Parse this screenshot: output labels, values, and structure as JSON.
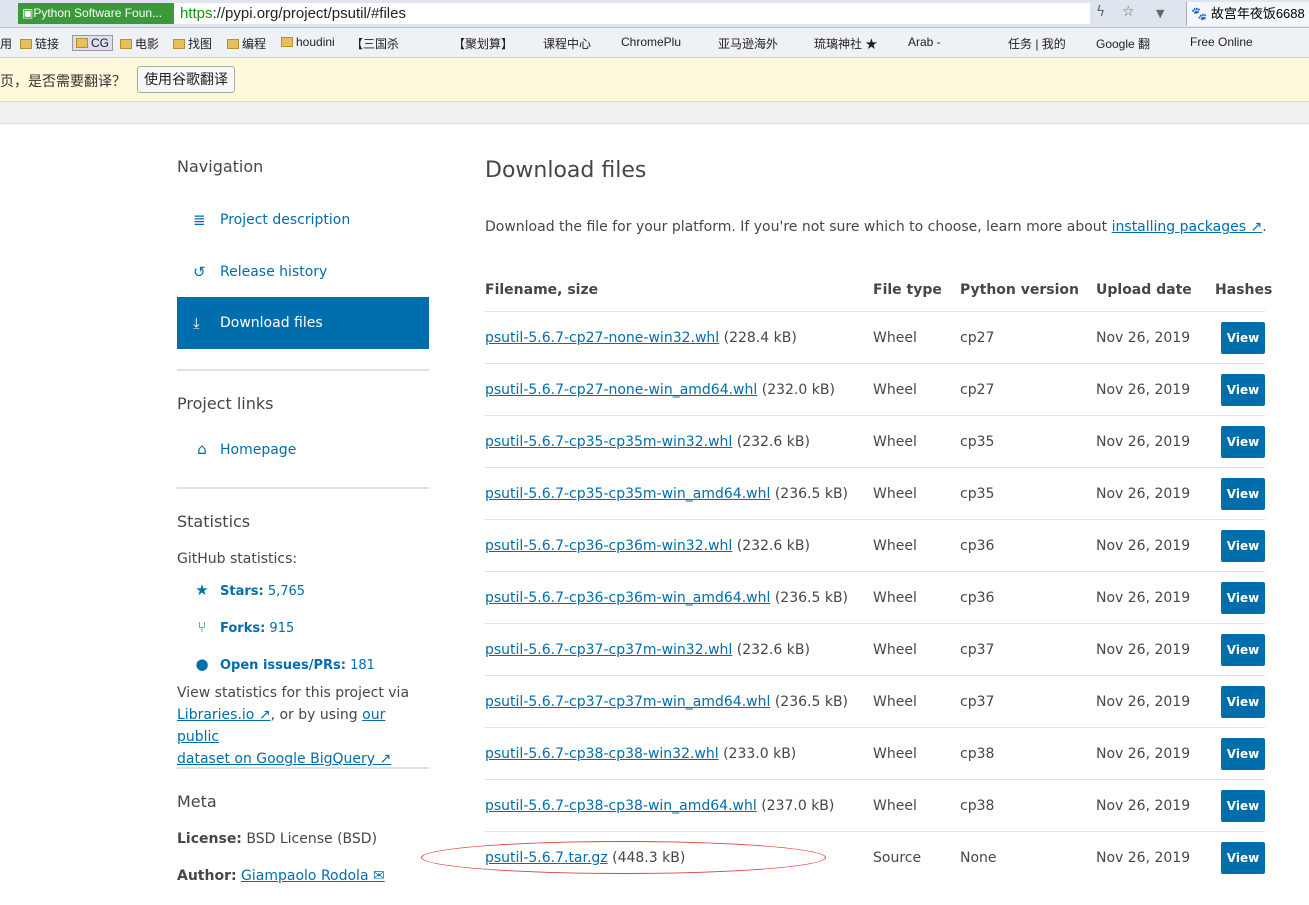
{
  "browser": {
    "site_badge": "Python Software Foun...",
    "url_protocol": "https",
    "url_rest": "://pypi.org/project/psutil/#files",
    "tab_title": "故宫年夜饭6688",
    "bookmarks": [
      "用",
      "链接",
      "CG",
      "电影",
      "找图",
      "编程",
      "houdini",
      "【三国杀",
      "【聚划算】",
      "课程中心",
      "ChromePlu",
      "亚马逊海外",
      "琉璃神社 ★",
      "Arab -",
      "任务 | 我的",
      "Google 翻",
      "Free Online"
    ]
  },
  "translate_bar": {
    "message": "页，是否需要翻译？",
    "button": "使用谷歌翻译"
  },
  "sidebar": {
    "navigation_title": "Navigation",
    "nav_items": [
      {
        "label": "Project description",
        "icon": "align-left-icon"
      },
      {
        "label": "Release history",
        "icon": "history-icon"
      },
      {
        "label": "Download files",
        "icon": "download-icon",
        "active": true
      }
    ],
    "project_links_title": "Project links",
    "homepage_label": "Homepage",
    "statistics_title": "Statistics",
    "github_stats_label": "GitHub statistics:",
    "stars_label": "Stars:",
    "stars_value": "5,765",
    "forks_label": "Forks:",
    "forks_value": "915",
    "issues_label": "Open issues/PRs:",
    "issues_value": "181",
    "stats_text_1": "View statistics for this project via",
    "libraries_link": "Libraries.io",
    "stats_text_2": ", or by using",
    "dataset_link_1": "our public",
    "dataset_link_2": "dataset on Google BigQuery",
    "meta_title": "Meta",
    "license_label": "License:",
    "license_value": "BSD License (BSD)",
    "author_label": "Author:",
    "author_value": "Giampaolo Rodola"
  },
  "main": {
    "title": "Download files",
    "intro_text": "Download the file for your platform. If you're not sure which to choose, learn more about",
    "intro_link": "installing packages",
    "intro_end": ".",
    "headers": {
      "filename": "Filename, size",
      "filetype": "File type",
      "pyversion": "Python version",
      "upload": "Upload date",
      "hashes": "Hashes"
    },
    "view_label": "View",
    "files": [
      {
        "name": "psutil-5.6.7-cp27-none-win32.whl",
        "size": "(228.4 kB)",
        "type": "Wheel",
        "py": "cp27",
        "date": "Nov 26, 2019"
      },
      {
        "name": "psutil-5.6.7-cp27-none-win_amd64.whl",
        "size": "(232.0 kB)",
        "type": "Wheel",
        "py": "cp27",
        "date": "Nov 26, 2019"
      },
      {
        "name": "psutil-5.6.7-cp35-cp35m-win32.whl",
        "size": "(232.6 kB)",
        "type": "Wheel",
        "py": "cp35",
        "date": "Nov 26, 2019"
      },
      {
        "name": "psutil-5.6.7-cp35-cp35m-win_amd64.whl",
        "size": "(236.5 kB)",
        "type": "Wheel",
        "py": "cp35",
        "date": "Nov 26, 2019"
      },
      {
        "name": "psutil-5.6.7-cp36-cp36m-win32.whl",
        "size": "(232.6 kB)",
        "type": "Wheel",
        "py": "cp36",
        "date": "Nov 26, 2019"
      },
      {
        "name": "psutil-5.6.7-cp36-cp36m-win_amd64.whl",
        "size": "(236.5 kB)",
        "type": "Wheel",
        "py": "cp36",
        "date": "Nov 26, 2019"
      },
      {
        "name": "psutil-5.6.7-cp37-cp37m-win32.whl",
        "size": "(232.6 kB)",
        "type": "Wheel",
        "py": "cp37",
        "date": "Nov 26, 2019"
      },
      {
        "name": "psutil-5.6.7-cp37-cp37m-win_amd64.whl",
        "size": "(236.5 kB)",
        "type": "Wheel",
        "py": "cp37",
        "date": "Nov 26, 2019"
      },
      {
        "name": "psutil-5.6.7-cp38-cp38-win32.whl",
        "size": "(233.0 kB)",
        "type": "Wheel",
        "py": "cp38",
        "date": "Nov 26, 2019"
      },
      {
        "name": "psutil-5.6.7-cp38-cp38-win_amd64.whl",
        "size": "(237.0 kB)",
        "type": "Wheel",
        "py": "cp38",
        "date": "Nov 26, 2019"
      },
      {
        "name": "psutil-5.6.7.tar.gz",
        "size": "(448.3 kB)",
        "type": "Source",
        "py": "None",
        "date": "Nov 26, 2019"
      }
    ]
  },
  "colors": {
    "link": "#006dad",
    "text": "#464646",
    "annotation": "#d9453e"
  }
}
